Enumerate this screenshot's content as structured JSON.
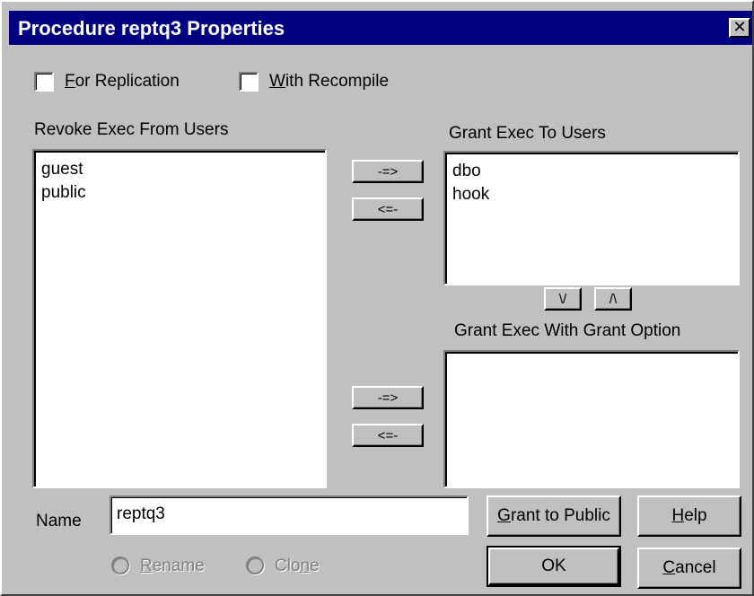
{
  "window": {
    "title": "Procedure reptq3 Properties",
    "close_glyph": "✕"
  },
  "options": {
    "for_replication": {
      "label": "For Replication",
      "hotkey": "F",
      "rest": "or Replication",
      "checked": false
    },
    "with_recompile": {
      "label": "With Recompile",
      "hotkey": "W",
      "rest": "ith Recompile",
      "checked": false
    }
  },
  "revoke": {
    "label": "Revoke Exec From Users",
    "items": [
      "guest",
      "public"
    ]
  },
  "grant": {
    "label": "Grant Exec To Users",
    "items": [
      "dbo",
      "hook"
    ]
  },
  "grant_option": {
    "label": "Grant Exec With Grant Option",
    "items": []
  },
  "arrows": {
    "move_right": "-=>",
    "move_left": "<=-",
    "move_down": "\\/",
    "move_up": "/\\"
  },
  "name": {
    "label": "Name",
    "value": "reptq3"
  },
  "radios": {
    "rename": {
      "label": "Rename",
      "hotkey": "R",
      "rest": "ename",
      "enabled": false
    },
    "clone": {
      "label": "Clone",
      "prefix": "Clo",
      "hotkey": "n",
      "rest": "e",
      "enabled": false
    }
  },
  "buttons": {
    "grant_public": {
      "label": "Grant to Public",
      "hotkey": "G",
      "rest": "rant to Public"
    },
    "help": {
      "label": "Help",
      "hotkey": "H",
      "rest": "elp"
    },
    "ok": {
      "label": "OK"
    },
    "cancel": {
      "label": "Cancel",
      "hotkey": "C",
      "rest": "ancel"
    }
  }
}
